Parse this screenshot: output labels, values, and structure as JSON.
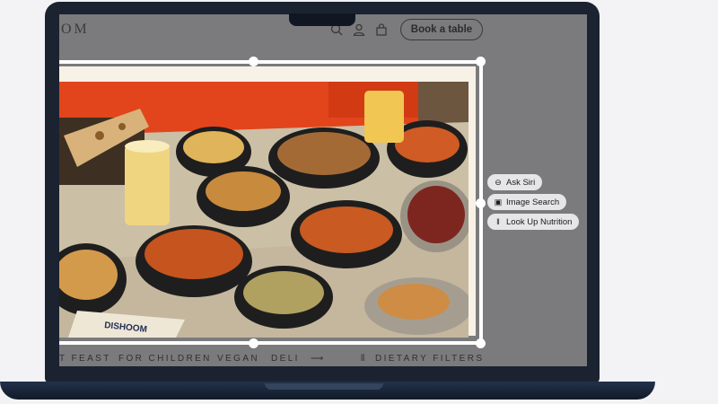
{
  "header": {
    "brand": "OM",
    "book_table_label": "Book a table",
    "icons": [
      "search-icon",
      "user-icon",
      "bag-icon"
    ]
  },
  "menu": {
    "items": [
      "T FEAST",
      "FOR CHILDREN",
      "VEGAN",
      "DELI"
    ],
    "dietary_filters_label": "DIETARY FILTERS"
  },
  "context_actions": [
    {
      "label": "Ask Siri",
      "icon": "siri-icon"
    },
    {
      "label": "Image Search",
      "icon": "image-search-icon"
    },
    {
      "label": "Look Up Nutrition",
      "icon": "utensils-icon"
    }
  ],
  "photo": {
    "tray_text": "DISHOOM"
  },
  "colors": {
    "laptop_body": "#1b2331",
    "dimmed_screen": "#7b7b7d",
    "wall_orange": "#e2451c",
    "pill_bg": "#e6e6e8"
  }
}
